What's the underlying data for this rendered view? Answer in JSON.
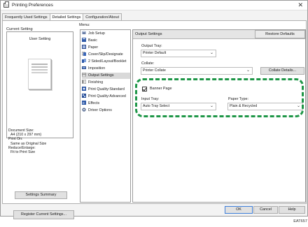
{
  "window": {
    "title": "Printing Preferences",
    "close_glyph": "✕"
  },
  "tabs": [
    {
      "label": "Frequently Used Settings"
    },
    {
      "label": "Detailed Settings",
      "active": true
    },
    {
      "label": "Configuration/About"
    }
  ],
  "current_setting": {
    "label": "Current Setting",
    "name": "User Setting",
    "info": [
      "Document Size:",
      "  A4 (210 x 297 mm)",
      "Print On:",
      "  Same as Original Size",
      "Reduce/Enlarge:",
      "  Fit to Print Size"
    ],
    "summary_button": "Settings Summary",
    "register_button": "Register Current Settings..."
  },
  "menu": {
    "label": "Menu:",
    "items": [
      {
        "label": "Job Setup",
        "icon": "job-setup-icon"
      },
      {
        "label": "Basic",
        "icon": "basic-icon"
      },
      {
        "label": "Paper",
        "icon": "paper-icon"
      },
      {
        "label": "Cover/Slip/Designate",
        "icon": "cover-icon"
      },
      {
        "label": "2 Sided/Layout/Booklet",
        "icon": "two-sided-icon"
      },
      {
        "label": "Imposition",
        "icon": "imposition-icon"
      },
      {
        "label": "Output Settings",
        "icon": "output-icon",
        "selected": true
      },
      {
        "label": "Finishing",
        "icon": "finishing-icon"
      },
      {
        "label": "Print Quality:Standard",
        "icon": "quality-standard-icon"
      },
      {
        "label": "Print Quality:Advanced",
        "icon": "quality-advanced-icon"
      },
      {
        "label": "Effects",
        "icon": "effects-icon"
      },
      {
        "label": "Driver Options",
        "icon": "driver-options-icon"
      }
    ]
  },
  "output_settings": {
    "title": "Output Settings",
    "restore_label": "Restore Defaults",
    "output_tray": {
      "label": "Output Tray:",
      "value": "Printer Default"
    },
    "collate": {
      "label": "Collate:",
      "value": "Printer Collate"
    },
    "collate_details_label": "Collate Details...",
    "banner_page": {
      "label": "Banner Page",
      "checked": true
    },
    "input_tray": {
      "label": "Input Tray:",
      "value": "Auto Tray Select"
    },
    "paper_type": {
      "label": "Paper Type:",
      "value": "Plain & Recycled"
    }
  },
  "buttons": {
    "ok": "OK",
    "cancel": "Cancel",
    "help": "Help"
  },
  "figure_code": "EAT657",
  "colors": {
    "highlight": "#1e9647",
    "selected_menu": "#d9d9d9",
    "header": "#e5e5e5"
  }
}
